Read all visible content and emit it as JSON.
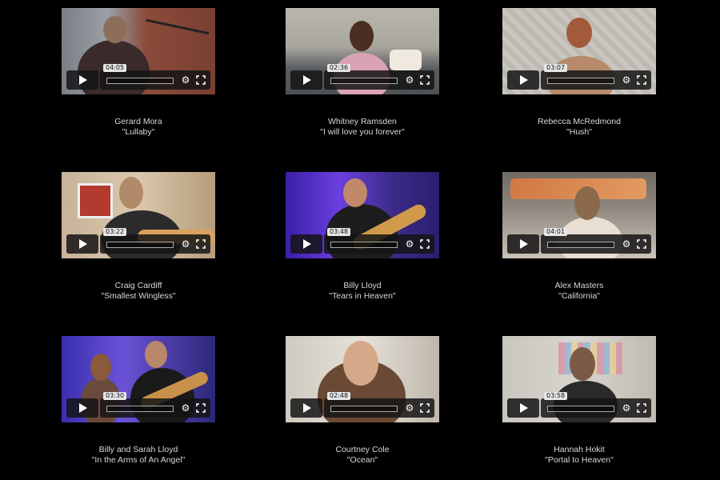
{
  "videos": [
    {
      "time": "04:05",
      "artist": "Gerard Mora",
      "song": "\"Lullaby\""
    },
    {
      "time": "02:36",
      "artist": "Whitney Ramsden",
      "song": "\"I will love you forever\""
    },
    {
      "time": "03:07",
      "artist": "Rebecca McRedmond",
      "song": "\"Hush\""
    },
    {
      "time": "03:22",
      "artist": "Craig Cardiff",
      "song": "\"Smallest Wingless\""
    },
    {
      "time": "03:48",
      "artist": "Billy Lloyd",
      "song": "\"Tears in Heaven\""
    },
    {
      "time": "04:01",
      "artist": "Alex Masters",
      "song": "\"California\""
    },
    {
      "time": "03:30",
      "artist": "Billy and Sarah Lloyd",
      "song": "\"In the Arms of An Angel\""
    },
    {
      "time": "02:48",
      "artist": "Courtney Cole",
      "song": "\"Ocean\""
    },
    {
      "time": "03:58",
      "artist": "Hannah Hokit",
      "song": "\"Portal to Heaven\""
    }
  ],
  "icons": {
    "play": "play-icon",
    "settings": "gear-icon",
    "fullscreen": "fullscreen-icon"
  },
  "colors": {
    "background": "#000000",
    "caption_text": "#d9d9d9",
    "control_bg": "#141414",
    "time_badge_bg": "#e6e6e6"
  }
}
